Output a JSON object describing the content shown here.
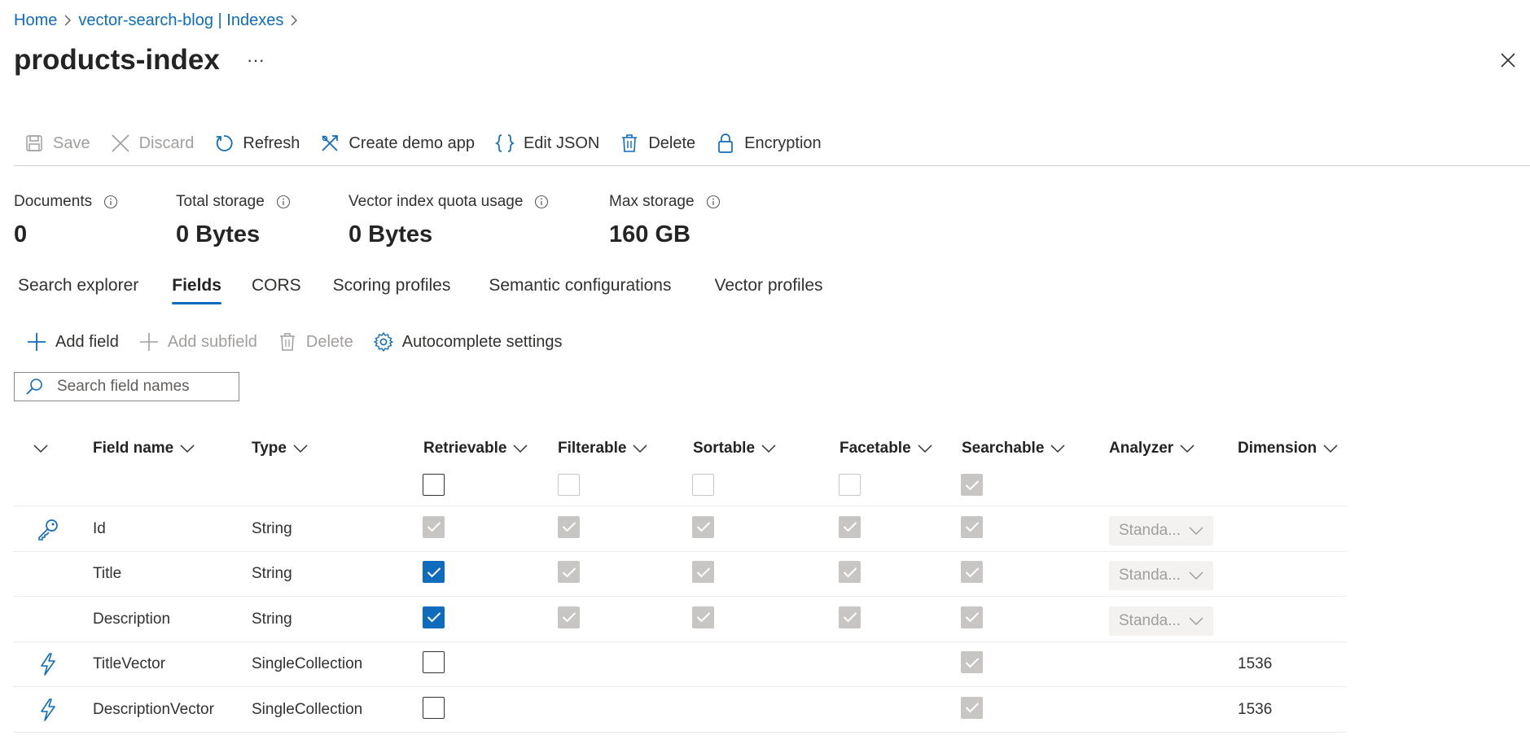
{
  "breadcrumb": {
    "home": "Home",
    "parent": "vector-search-blog | Indexes"
  },
  "page": {
    "title": "products-index",
    "more": "···"
  },
  "toolbar": {
    "save": "Save",
    "discard": "Discard",
    "refresh": "Refresh",
    "create_demo_app": "Create demo app",
    "edit_json": "Edit JSON",
    "delete": "Delete",
    "encryption": "Encryption"
  },
  "stats": {
    "documents": {
      "label": "Documents",
      "value": "0"
    },
    "total_storage": {
      "label": "Total storage",
      "value": "0 Bytes"
    },
    "vector_quota": {
      "label": "Vector index quota usage",
      "value": "0 Bytes"
    },
    "max_storage": {
      "label": "Max storage",
      "value": "160 GB"
    }
  },
  "tabs": [
    "Search explorer",
    "Fields",
    "CORS",
    "Scoring profiles",
    "Semantic configurations",
    "Vector profiles"
  ],
  "active_tab": "Fields",
  "fields_toolbar": {
    "add_field": "Add field",
    "add_subfield": "Add subfield",
    "delete": "Delete",
    "autocomplete": "Autocomplete settings"
  },
  "search": {
    "placeholder": "Search field names"
  },
  "table": {
    "columns": {
      "field_name": "Field name",
      "type": "Type",
      "retrievable": "Retrievable",
      "filterable": "Filterable",
      "sortable": "Sortable",
      "facetable": "Facetable",
      "searchable": "Searchable",
      "analyzer": "Analyzer",
      "dimension": "Dimension"
    },
    "header_checks": {
      "retrievable": "unchecked",
      "filterable": "unchecked-disabled",
      "sortable": "unchecked-disabled",
      "facetable": "unchecked-disabled",
      "searchable": "checked-disabled"
    },
    "rows": [
      {
        "icon": "key-icon",
        "name": "Id",
        "type": "String",
        "retrievable": "checked-disabled",
        "filterable": "checked-disabled",
        "sortable": "checked-disabled",
        "facetable": "checked-disabled",
        "searchable": "checked-disabled",
        "analyzer": "Standa...",
        "dimension": ""
      },
      {
        "icon": "",
        "name": "Title",
        "type": "String",
        "retrievable": "checked",
        "filterable": "checked-disabled",
        "sortable": "checked-disabled",
        "facetable": "checked-disabled",
        "searchable": "checked-disabled",
        "analyzer": "Standa...",
        "dimension": ""
      },
      {
        "icon": "",
        "name": "Description",
        "type": "String",
        "retrievable": "checked",
        "filterable": "checked-disabled",
        "sortable": "checked-disabled",
        "facetable": "checked-disabled",
        "searchable": "checked-disabled",
        "analyzer": "Standa...",
        "dimension": ""
      },
      {
        "icon": "lightning-icon",
        "name": "TitleVector",
        "type": "SingleCollection",
        "retrievable": "unchecked",
        "filterable": "",
        "sortable": "",
        "facetable": "",
        "searchable": "checked-disabled",
        "analyzer": "",
        "dimension": "1536"
      },
      {
        "icon": "lightning-icon",
        "name": "DescriptionVector",
        "type": "SingleCollection",
        "retrievable": "unchecked",
        "filterable": "",
        "sortable": "",
        "facetable": "",
        "searchable": "checked-disabled",
        "analyzer": "",
        "dimension": "1536"
      }
    ]
  },
  "colors": {
    "accent": "#0f6cbd",
    "text": "#323130",
    "disabled": "#a19f9d",
    "disabled_check": "#c8c6c4"
  }
}
